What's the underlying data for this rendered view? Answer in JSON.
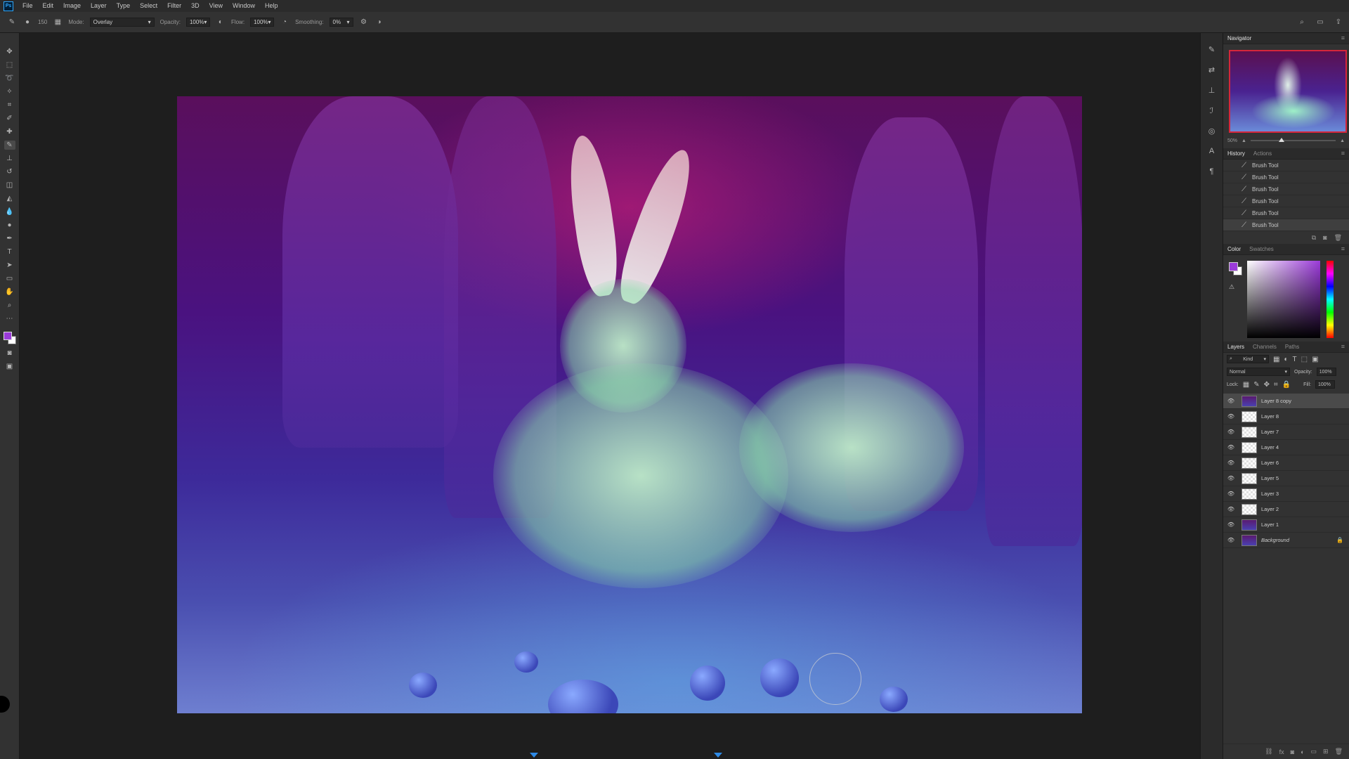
{
  "menubar": {
    "logo": "Ps",
    "items": [
      "File",
      "Edit",
      "Image",
      "Layer",
      "Type",
      "Select",
      "Filter",
      "3D",
      "View",
      "Window",
      "Help"
    ]
  },
  "options": {
    "brush_size": "150",
    "mode_label": "Mode:",
    "mode_value": "Overlay",
    "opacity_label": "Opacity:",
    "opacity_value": "100%",
    "flow_label": "Flow:",
    "flow_value": "100%",
    "smoothing_label": "Smoothing:",
    "smoothing_value": "0%"
  },
  "colors": {
    "foreground": "#9b3bd9",
    "background": "#ffffff",
    "accent": "#2e8ae6",
    "navigator_border": "#d5263b"
  },
  "navigator": {
    "tab": "Navigator",
    "zoom": "50%"
  },
  "history": {
    "tabs": [
      "History",
      "Actions"
    ],
    "items": [
      "Brush Tool",
      "Brush Tool",
      "Brush Tool",
      "Brush Tool",
      "Brush Tool",
      "Brush Tool"
    ],
    "selected_index": 5
  },
  "color_panel": {
    "tabs": [
      "Color",
      "Swatches"
    ]
  },
  "layers": {
    "tabs": [
      "Layers",
      "Channels",
      "Paths"
    ],
    "kind_filter": "Kind",
    "blend_mode": "Normal",
    "opacity_label": "Opacity:",
    "opacity_value": "100%",
    "lock_label": "Lock:",
    "fill_label": "Fill:",
    "fill_value": "100%",
    "items": [
      {
        "name": "Layer 8 copy",
        "selected": true,
        "thumb": "art"
      },
      {
        "name": "Layer 8",
        "selected": false,
        "thumb": "transparent"
      },
      {
        "name": "Layer 7",
        "selected": false,
        "thumb": "transparent"
      },
      {
        "name": "Layer 4",
        "selected": false,
        "thumb": "transparent"
      },
      {
        "name": "Layer 6",
        "selected": false,
        "thumb": "transparent"
      },
      {
        "name": "Layer 5",
        "selected": false,
        "thumb": "transparent"
      },
      {
        "name": "Layer 3",
        "selected": false,
        "thumb": "transparent"
      },
      {
        "name": "Layer 2",
        "selected": false,
        "thumb": "transparent"
      },
      {
        "name": "Layer 1",
        "selected": false,
        "thumb": "art"
      },
      {
        "name": "Background",
        "selected": false,
        "thumb": "art",
        "locked": true
      }
    ]
  }
}
